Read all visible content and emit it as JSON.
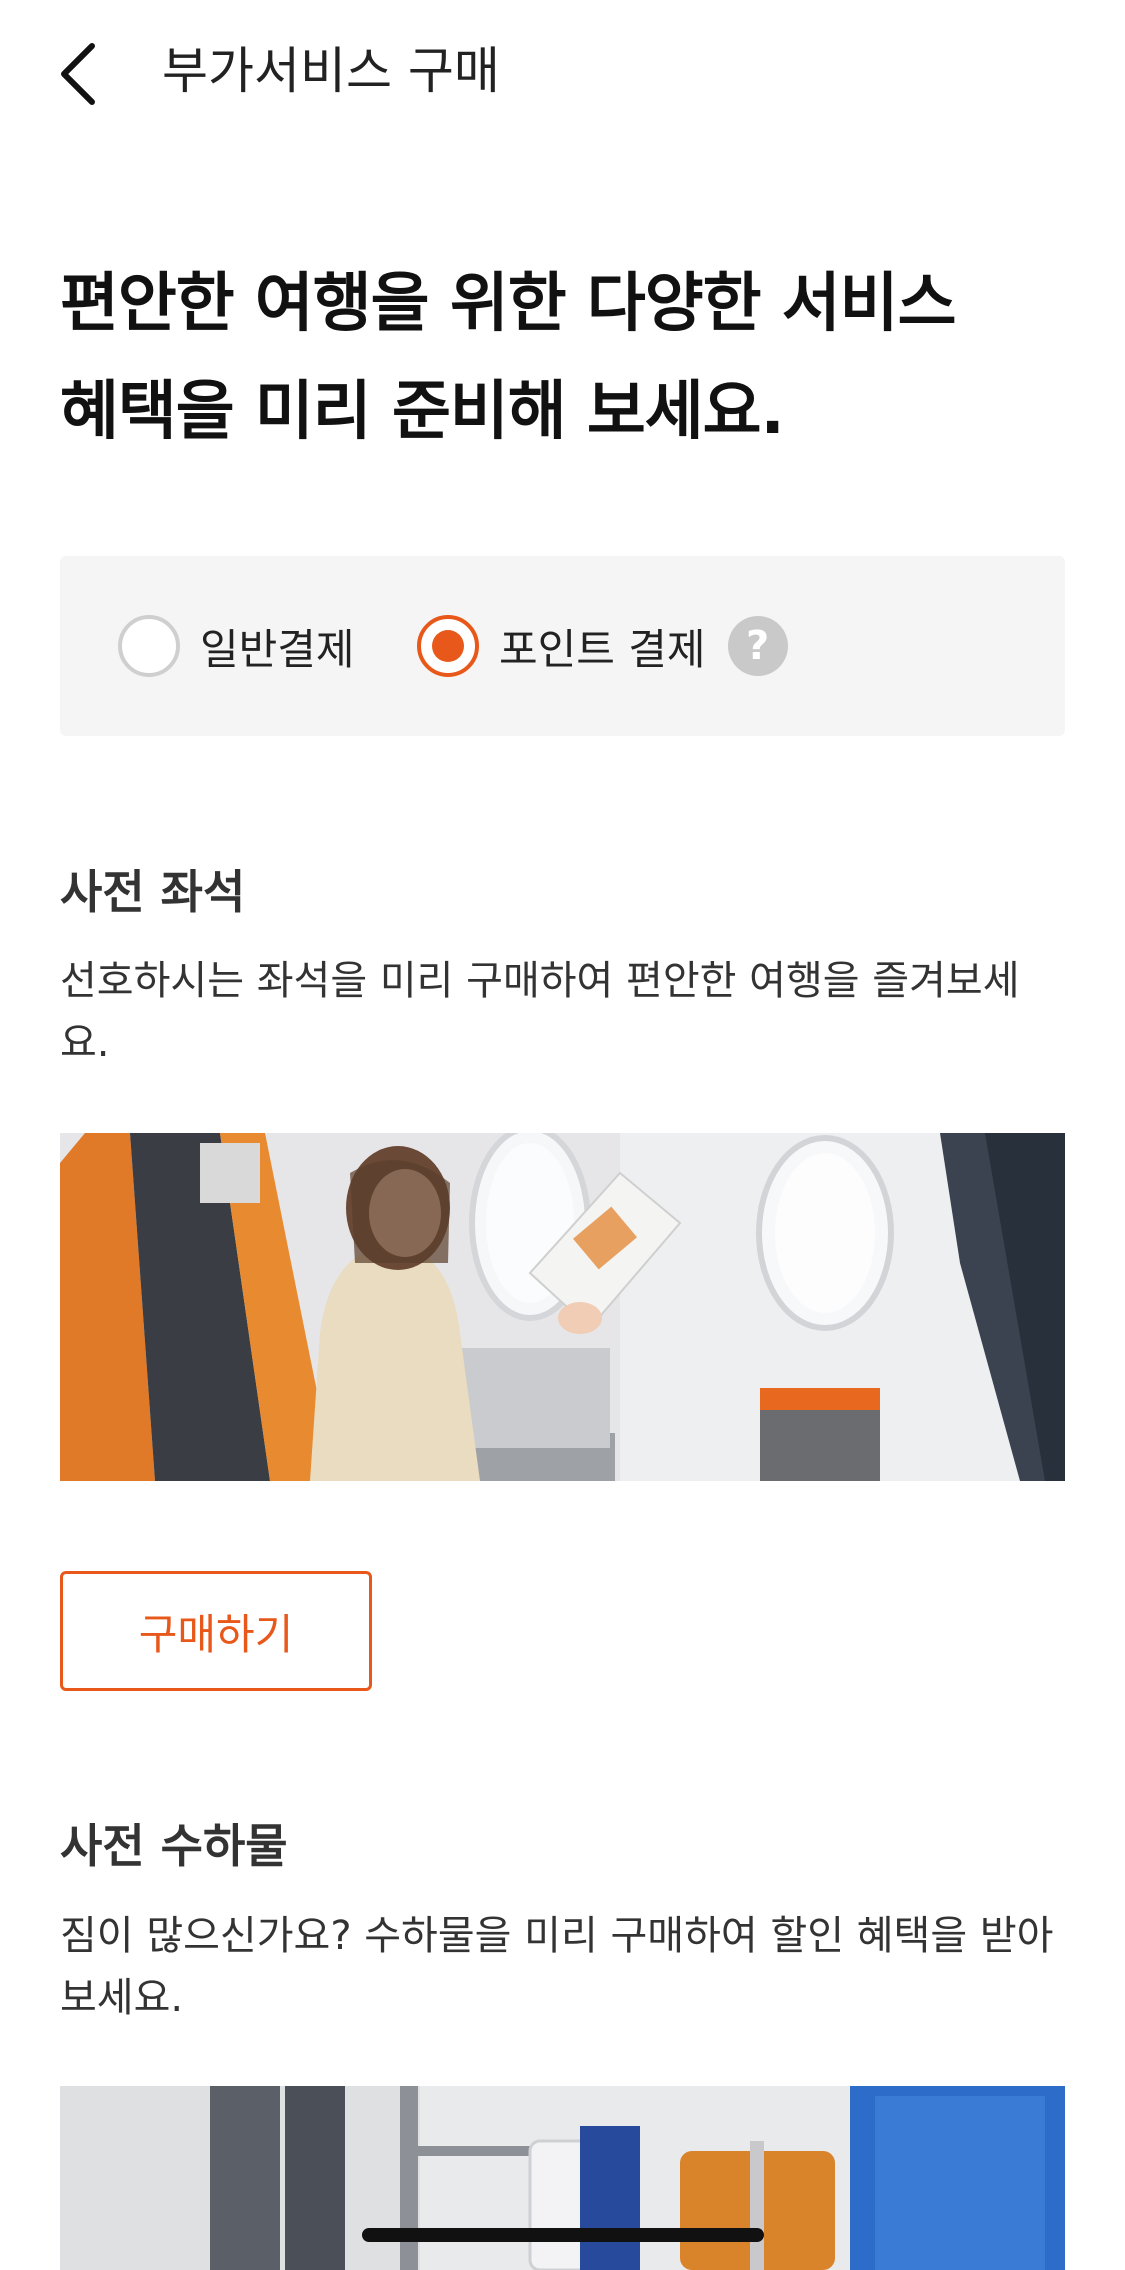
{
  "header": {
    "title": "부가서비스 구매",
    "back_icon": "chevron-left-icon"
  },
  "headline": {
    "line1": "편안한 여행을 위한 다양한 서비스",
    "line2": "혜택을 미리 준비해 보세요."
  },
  "payment": {
    "options": [
      {
        "label": "일반결제",
        "selected": false
      },
      {
        "label": "포인트 결제",
        "selected": true
      }
    ],
    "help_icon_glyph": "?",
    "accent_color": "#e8581a"
  },
  "sections": [
    {
      "title": "사전 좌석",
      "desc_line1": "선호하시는 좌석을 미리 구매하여 편안한 여행을 즐겨보세",
      "desc_line2": "요.",
      "button": "구매하기",
      "image": "woman-reading-in-airplane-seat"
    },
    {
      "title": "사전 수하물",
      "desc_line1": "짐이 많으신가요? 수하물을 미리 구매하여 할인 혜택을 받아",
      "desc_line2": "보세요.",
      "image": "luggage-trolley-in-airport"
    }
  ]
}
